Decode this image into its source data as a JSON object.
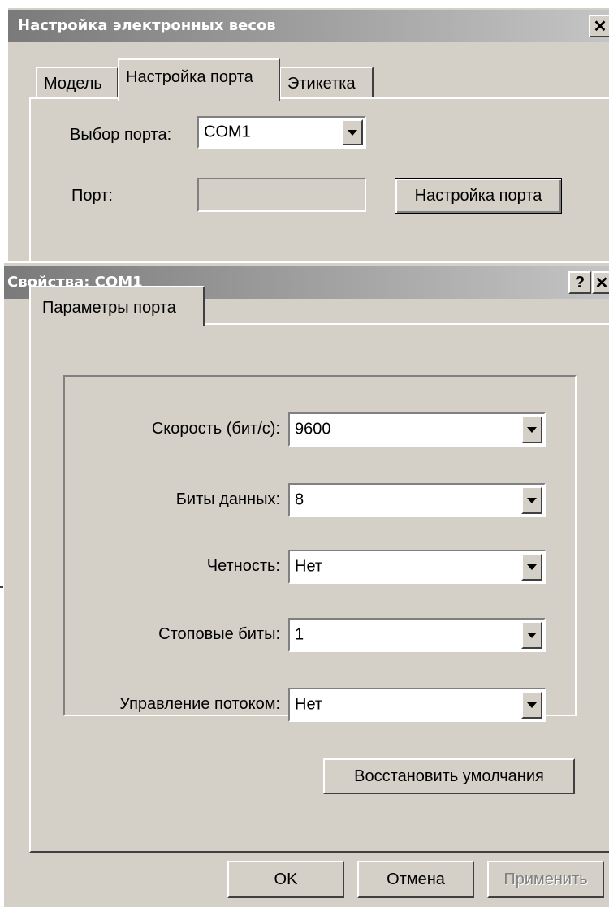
{
  "scales_window": {
    "title": "Настройка электронных весов",
    "close_glyph": "✕",
    "tabs": [
      {
        "label": "Модель"
      },
      {
        "label": "Настройка порта"
      },
      {
        "label": "Этикетка"
      }
    ],
    "port_select_label": "Выбор порта:",
    "port_select_value": "COM1",
    "port_label": "Порт:",
    "port_value": "",
    "port_settings_button": "Настройка порта"
  },
  "properties_dialog": {
    "title": "Свойства: COM1",
    "help_glyph": "?",
    "close_glyph": "✕",
    "tab": "Параметры порта",
    "fields": [
      {
        "label": "Скорость (бит/с):",
        "value": "9600"
      },
      {
        "label": "Биты данных:",
        "value": "8"
      },
      {
        "label": "Четность:",
        "value": "Нет"
      },
      {
        "label": "Стоповые биты:",
        "value": "1"
      },
      {
        "label": "Управление потоком:",
        "value": "Нет"
      }
    ],
    "restore_defaults_button": "Восстановить умолчания",
    "ok_button": "OK",
    "cancel_button": "Отмена",
    "apply_button": "Применить",
    "apply_disabled": true
  }
}
